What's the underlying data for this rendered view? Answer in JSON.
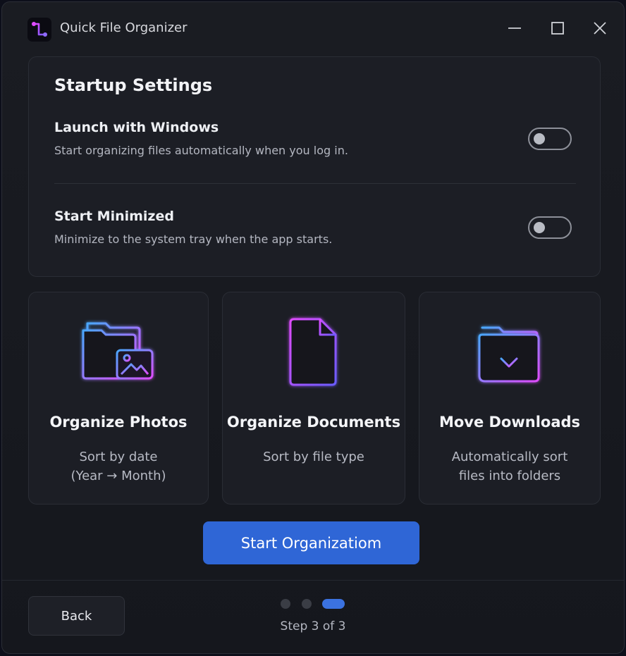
{
  "window": {
    "title": "Quick File Organizer",
    "minimize_icon": "minimize-icon",
    "maximize_icon": "maximize-icon",
    "close_icon": "close-icon"
  },
  "startup": {
    "title": "Startup Settings",
    "settings": [
      {
        "name": "Launch with Windows",
        "description": "Start organizing files automatically when you log in.",
        "enabled": false
      },
      {
        "name": "Start Minimized",
        "description": "Minimize to the system tray when the app starts.",
        "enabled": false
      }
    ]
  },
  "actions": [
    {
      "title": "Organize Photos",
      "description_lines": [
        "Sort by date",
        "(Year → Month)"
      ],
      "icon": "photo-folder-icon"
    },
    {
      "title": "Organize Documents",
      "description_lines": [
        "Sort by file type"
      ],
      "icon": "document-icon"
    },
    {
      "title": "Move Downloads",
      "description_lines": [
        "Automatically sort",
        "files into folders"
      ],
      "icon": "download-folder-icon"
    }
  ],
  "primary_button": "Start Organizatiom",
  "footer": {
    "back_label": "Back",
    "step_text": "Step 3 of 3",
    "current_step": 3,
    "total_steps": 3
  },
  "colors": {
    "accent": "#2f66d6",
    "neon_blue": "#4aa8ff",
    "neon_pink": "#e04cff"
  }
}
